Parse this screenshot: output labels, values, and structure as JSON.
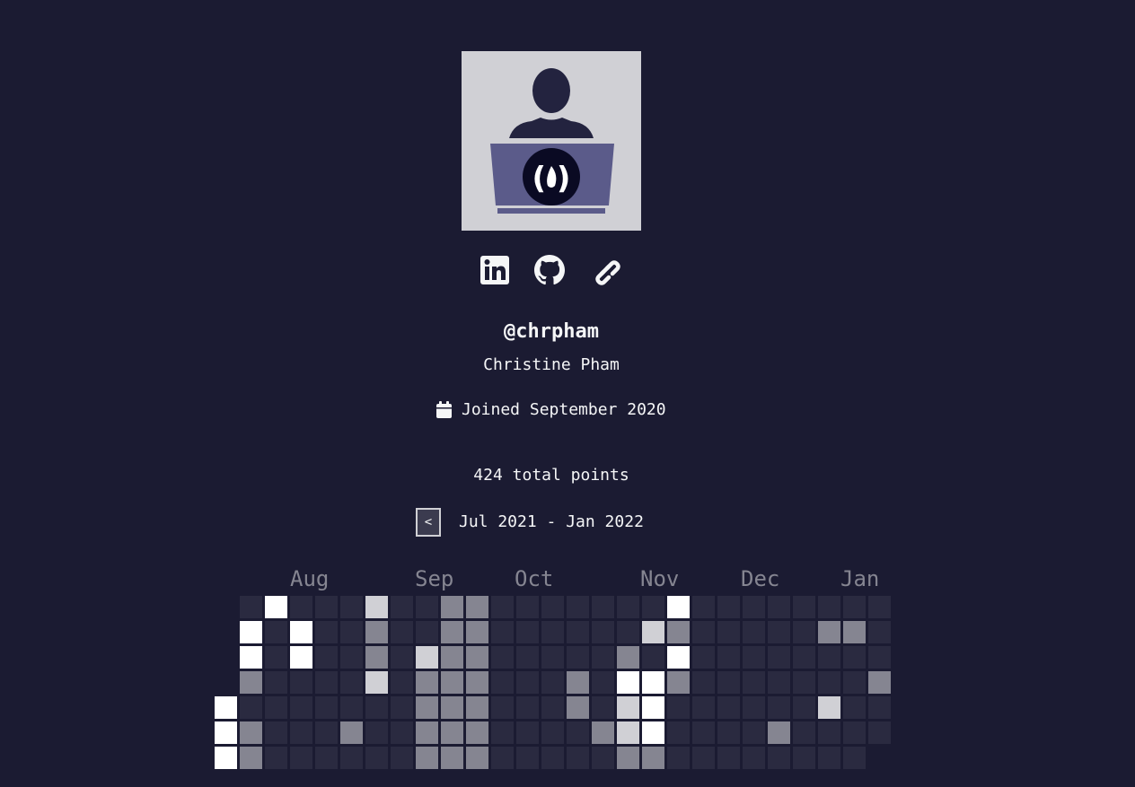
{
  "profile": {
    "username": "@chrpham",
    "name": "Christine Pham",
    "joined": "Joined September 2020",
    "points": "424 total points"
  },
  "socials": [
    {
      "icon": "linkedin-icon",
      "label": "LinkedIn"
    },
    {
      "icon": "github-icon",
      "label": "GitHub"
    },
    {
      "icon": "link-icon",
      "label": "Website"
    }
  ],
  "heatmap": {
    "prev_label": "<",
    "range": "Jul 2021 - Jan 2022",
    "months": [
      "Aug",
      "Sep",
      "Oct",
      "Nov",
      "Dec",
      "Jan"
    ],
    "levels_colors": [
      "#2a2a40",
      "#858591",
      "#d0d0d5",
      "#ffffff"
    ],
    "weeks": [
      [
        null,
        null,
        null,
        null,
        3,
        3,
        3
      ],
      [
        0,
        3,
        3,
        1,
        0,
        1,
        1
      ],
      [
        3,
        0,
        0,
        0,
        0,
        0,
        0
      ],
      [
        0,
        3,
        3,
        0,
        0,
        0,
        0
      ],
      [
        0,
        0,
        0,
        0,
        0,
        0,
        0
      ],
      [
        0,
        0,
        0,
        0,
        0,
        1,
        0
      ],
      [
        2,
        1,
        1,
        2,
        0,
        0,
        0
      ],
      [
        0,
        0,
        0,
        0,
        0,
        0,
        0
      ],
      [
        0,
        0,
        2,
        1,
        1,
        1,
        1
      ],
      [
        1,
        1,
        1,
        1,
        1,
        1,
        1
      ],
      [
        1,
        1,
        1,
        1,
        1,
        1,
        1
      ],
      [
        0,
        0,
        0,
        0,
        0,
        0,
        0
      ],
      [
        0,
        0,
        0,
        0,
        0,
        0,
        0
      ],
      [
        0,
        0,
        0,
        0,
        0,
        0,
        0
      ],
      [
        0,
        0,
        0,
        1,
        1,
        0,
        0
      ],
      [
        0,
        0,
        0,
        0,
        0,
        1,
        0
      ],
      [
        0,
        0,
        1,
        3,
        2,
        2,
        1
      ],
      [
        0,
        2,
        0,
        3,
        3,
        3,
        1
      ],
      [
        3,
        1,
        3,
        1,
        0,
        0,
        0
      ],
      [
        0,
        0,
        0,
        0,
        0,
        0,
        0
      ],
      [
        0,
        0,
        0,
        0,
        0,
        0,
        0
      ],
      [
        0,
        0,
        0,
        0,
        0,
        0,
        0
      ],
      [
        0,
        0,
        0,
        0,
        0,
        1,
        0
      ],
      [
        0,
        0,
        0,
        0,
        0,
        0,
        0
      ],
      [
        0,
        1,
        0,
        0,
        2,
        0,
        0
      ],
      [
        0,
        1,
        0,
        0,
        0,
        0,
        0
      ],
      [
        0,
        0,
        0,
        1,
        0,
        0,
        null
      ]
    ]
  }
}
